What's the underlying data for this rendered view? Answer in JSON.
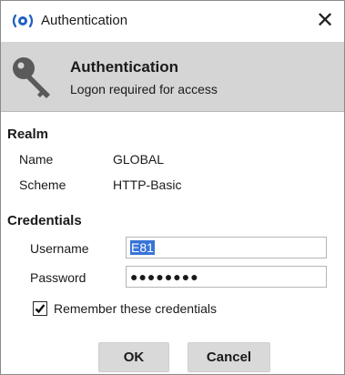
{
  "window": {
    "title": "Authentication",
    "close_glyph": "✕"
  },
  "banner": {
    "title": "Authentication",
    "subtitle": "Logon required for access",
    "icon": "key-icon"
  },
  "realm": {
    "heading": "Realm",
    "name_label": "Name",
    "name_value": "GLOBAL",
    "scheme_label": "Scheme",
    "scheme_value": "HTTP-Basic"
  },
  "credentials": {
    "heading": "Credentials",
    "username_label": "Username",
    "username_value": "E81",
    "password_label": "Password",
    "password_value": "●●●●●●●●",
    "remember_label": "Remember these credentials",
    "remember_checked": true
  },
  "buttons": {
    "ok_label": "OK",
    "cancel_label": "Cancel"
  },
  "colors": {
    "banner_bg": "#d5d5d5",
    "selection": "#3874d8",
    "brand_icon": "#1f5fc0"
  }
}
